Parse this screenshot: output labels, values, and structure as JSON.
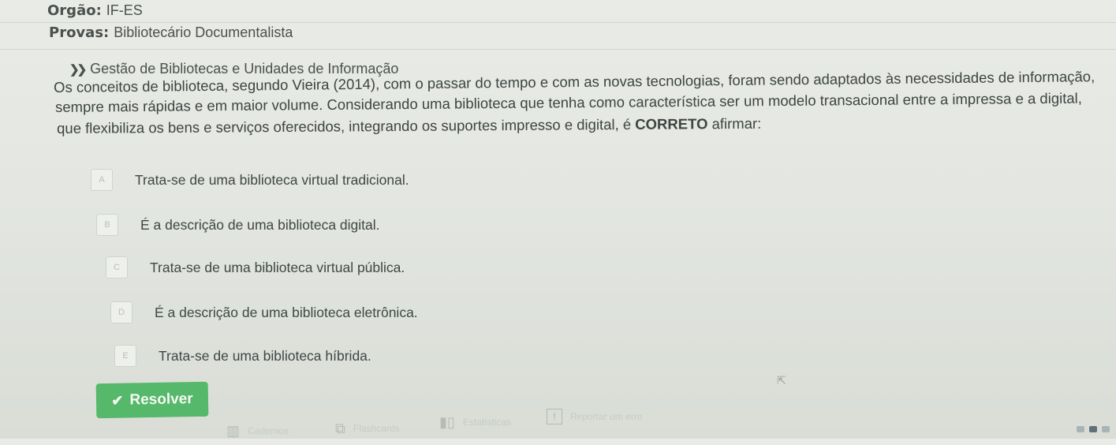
{
  "header": {
    "orgao_label": "Orgão:",
    "orgao_value": "IF-ES",
    "provas_label": "Provas:",
    "provas_value": "Bibliotecário Documentalista"
  },
  "question": {
    "subject": "Gestão de Bibliotecas e Unidades de Informação",
    "line1": "Os conceitos de biblioteca, segundo Vieira (2014), com o passar do tempo e com as novas tecnologias, foram sendo adaptados às necessidades de informação,",
    "line2": "sempre mais rápidas e em maior volume. Considerando uma biblioteca que tenha como característica ser um modelo transacional entre a impressa e a digital,",
    "line3_a": "que flexibiliza os bens e serviços oferecidos, integrando os suportes impresso e digital, é ",
    "line3_strong": "CORRETO",
    "line3_b": " afirmar:"
  },
  "options": [
    {
      "letter": "A",
      "text": "Trata-se de uma biblioteca virtual tradicional."
    },
    {
      "letter": "B",
      "text": "É a descrição de uma biblioteca digital."
    },
    {
      "letter": "C",
      "text": "Trata-se de uma biblioteca virtual pública."
    },
    {
      "letter": "D",
      "text": "É a descrição de uma biblioteca eletrônica."
    },
    {
      "letter": "E",
      "text": "Trata-se de uma biblioteca híbrida."
    }
  ],
  "actions": {
    "resolve_label": "Resolver"
  },
  "toolbar": {
    "cadernos": "Cadernos",
    "flashcards": "Flashcards",
    "estatisticas": "Estatísticas",
    "reportar": "Reportar um erro"
  },
  "colors": {
    "resolve_button": "#55b86a",
    "background": "#e6e9e4",
    "text": "#3f4744"
  },
  "icons": {
    "check": "check-icon",
    "chevrons": "double-chevron-right-icon",
    "cadernos": "notebook-icon",
    "flashcards": "cards-icon",
    "estatisticas": "bar-chart-icon",
    "reportar": "warning-icon"
  }
}
